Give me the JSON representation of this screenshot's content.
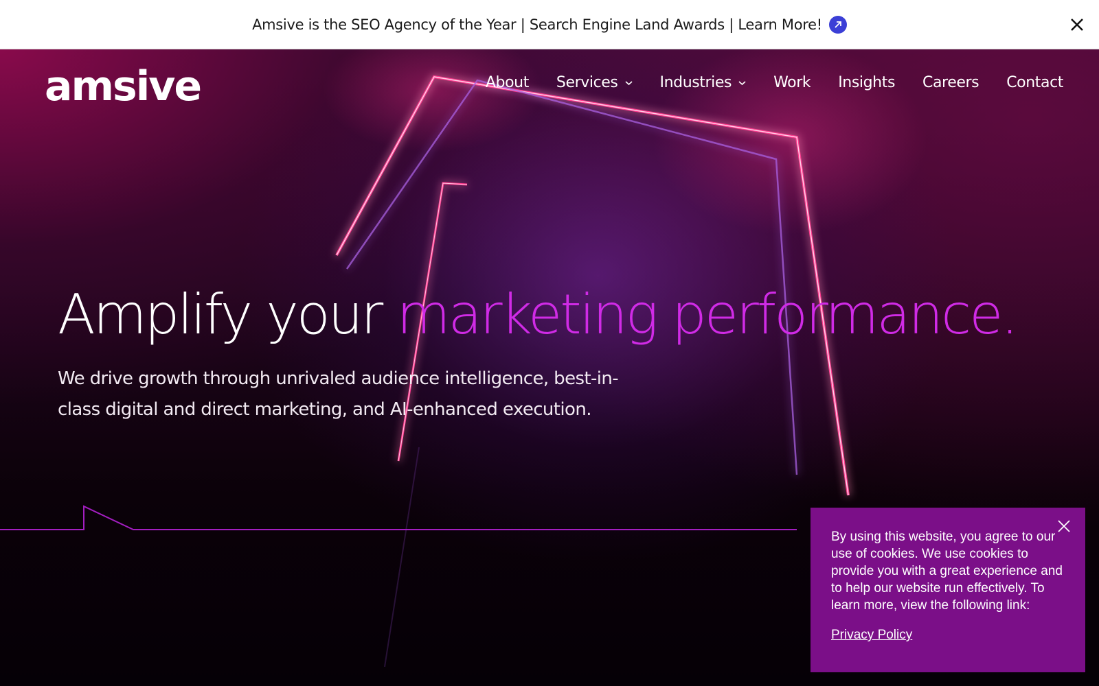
{
  "announcement": {
    "text": "Amsive is the SEO Agency of the Year | Search Engine Land Awards | Learn More!",
    "arrow_icon": "arrow-up-right-icon",
    "close_icon": "close-icon"
  },
  "brand": {
    "logo_text": "amsive"
  },
  "nav": {
    "items": [
      {
        "label": "About",
        "has_dropdown": false
      },
      {
        "label": "Services",
        "has_dropdown": true
      },
      {
        "label": "Industries",
        "has_dropdown": true
      },
      {
        "label": "Work",
        "has_dropdown": false
      },
      {
        "label": "Insights",
        "has_dropdown": false
      },
      {
        "label": "Careers",
        "has_dropdown": false
      },
      {
        "label": "Contact",
        "has_dropdown": false
      }
    ]
  },
  "hero": {
    "headline_plain": "Amplify your ",
    "headline_accent": "marketing performance.",
    "subtext": "We drive growth through unrivaled audience intelligence, best-in-class digital and direct marketing, and AI-enhanced execution."
  },
  "cookie": {
    "text": "By using this website, you agree to our use of cookies. We use cookies to provide you with a great experience and to help our website run effectively. To learn more, view the following link:",
    "link_label": "Privacy Policy"
  },
  "colors": {
    "accent_magenta": "#d02be6",
    "cookie_bg": "#7b0f88",
    "arrow_badge": "#3b3fd6",
    "hero_dark": "#0b0109"
  }
}
